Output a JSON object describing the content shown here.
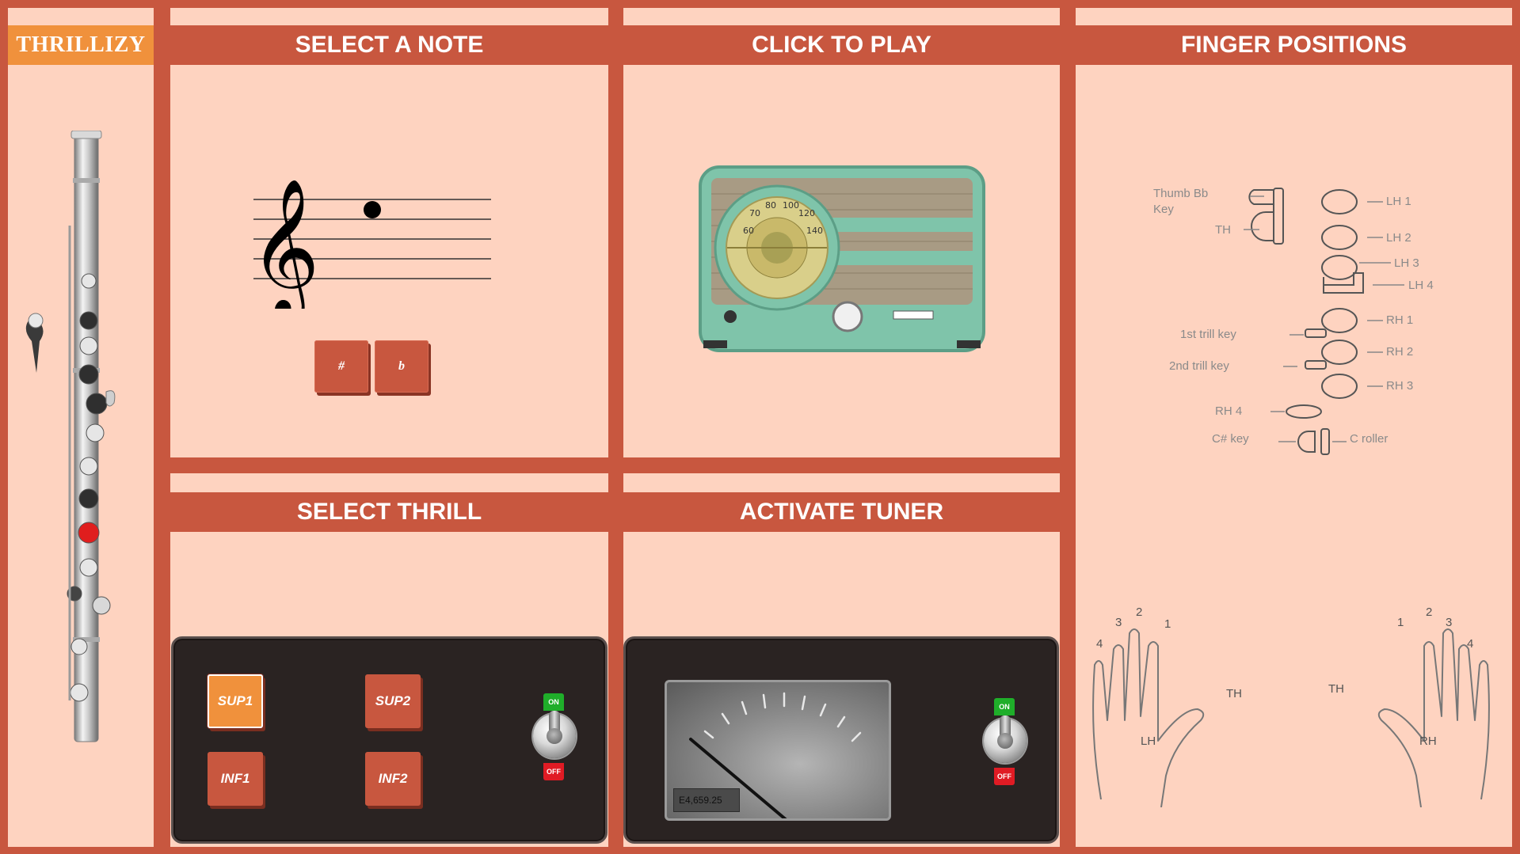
{
  "app": {
    "logo": "THRILLIZY"
  },
  "headers": {
    "select_note": "SELECT A NOTE",
    "click_to_play": "CLICK TO PLAY",
    "finger_positions": "FINGER POSITIONS",
    "select_thrill": "SELECT THRILL",
    "activate_tuner": "ACTIVATE TUNER"
  },
  "note_panel": {
    "sharp_label": "#",
    "flat_label": "b"
  },
  "thrill_panel": {
    "buttons": [
      {
        "label": "SUP1",
        "active": true
      },
      {
        "label": "SUP2",
        "active": false
      },
      {
        "label": "INF1",
        "active": false
      },
      {
        "label": "INF2",
        "active": false
      }
    ],
    "toggle": {
      "on_label": "ON",
      "off_label": "OFF"
    }
  },
  "tuner_panel": {
    "readout": "E4,659.25",
    "toggle": {
      "on_label": "ON",
      "off_label": "OFF"
    }
  },
  "radio": {
    "dial_numbers": [
      "60",
      "70",
      "80",
      "100",
      "120",
      "140"
    ]
  },
  "fingering_chart": {
    "labels": {
      "thumb_bb": "Thumb Bb",
      "key": "Key",
      "th": "TH",
      "lh1": "LH 1",
      "lh2": "LH 2",
      "lh3": "LH 3",
      "lh4": "LH 4",
      "trill1": "1st trill key",
      "rh1": "RH 1",
      "trill2": "2nd trill key",
      "rh2": "RH 2",
      "rh3": "RH 3",
      "rh4": "RH 4",
      "csharp": "C# key",
      "croller": "C roller"
    }
  },
  "hands": {
    "left": {
      "label": "LH",
      "thumb": "TH",
      "fingers": [
        "1",
        "2",
        "3",
        "4"
      ]
    },
    "right": {
      "label": "RH",
      "thumb": "TH",
      "fingers": [
        "1",
        "2",
        "3",
        "4"
      ]
    }
  },
  "colors": {
    "frame": "#c8573f",
    "panel": "#fed3c0",
    "accent": "#f0913c",
    "dark": "#2a2322",
    "radio": "#7fc4aa"
  }
}
